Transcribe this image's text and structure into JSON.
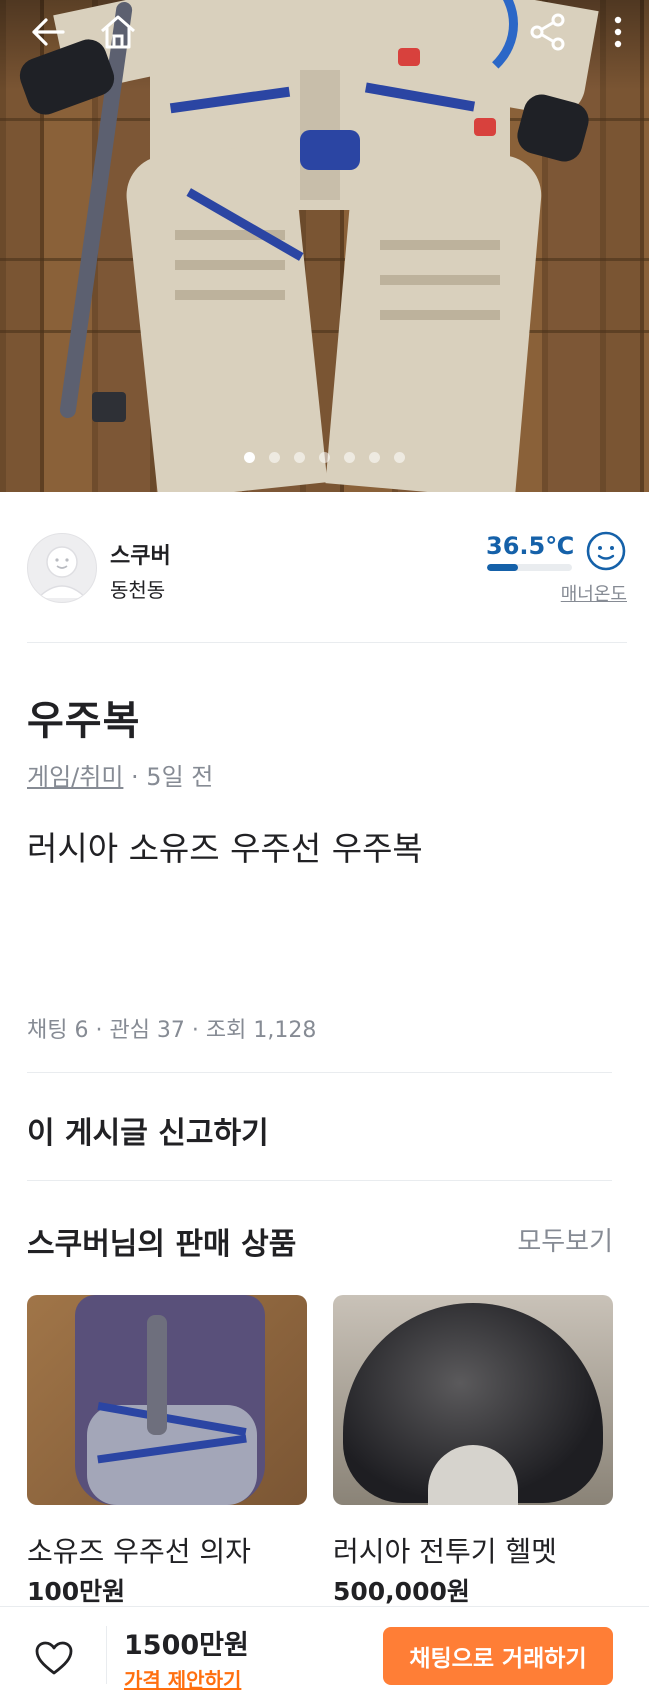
{
  "carousel": {
    "total": 7,
    "active": 0
  },
  "seller": {
    "name": "스쿠버",
    "location": "동천동",
    "temperature": "36.5℃",
    "temperature_fill": 0.365,
    "manner_label": "매너온도"
  },
  "post": {
    "title": "우주복",
    "category": "게임/취미",
    "time": " · 5일 전",
    "description": "러시아 소유즈 우주선 우주복",
    "stats": "채팅 6 · 관심 37 · 조회 1,128"
  },
  "report_label": "이 게시글 신고하기",
  "seller_items": {
    "title": "스쿠버님의 판매 상품",
    "see_all": "모두보기",
    "items": [
      {
        "name": "소유즈 우주선 의자",
        "price": "100만원"
      },
      {
        "name": "러시아 전투기 헬멧",
        "price": "500,000원"
      }
    ]
  },
  "bottom_bar": {
    "price": "1500만원",
    "offer_label": "가격 제안하기",
    "chat_label": "채팅으로 거래하기"
  },
  "colors": {
    "accent": "#ff7e36",
    "temperature": "#1561a9",
    "muted": "#868b94"
  }
}
